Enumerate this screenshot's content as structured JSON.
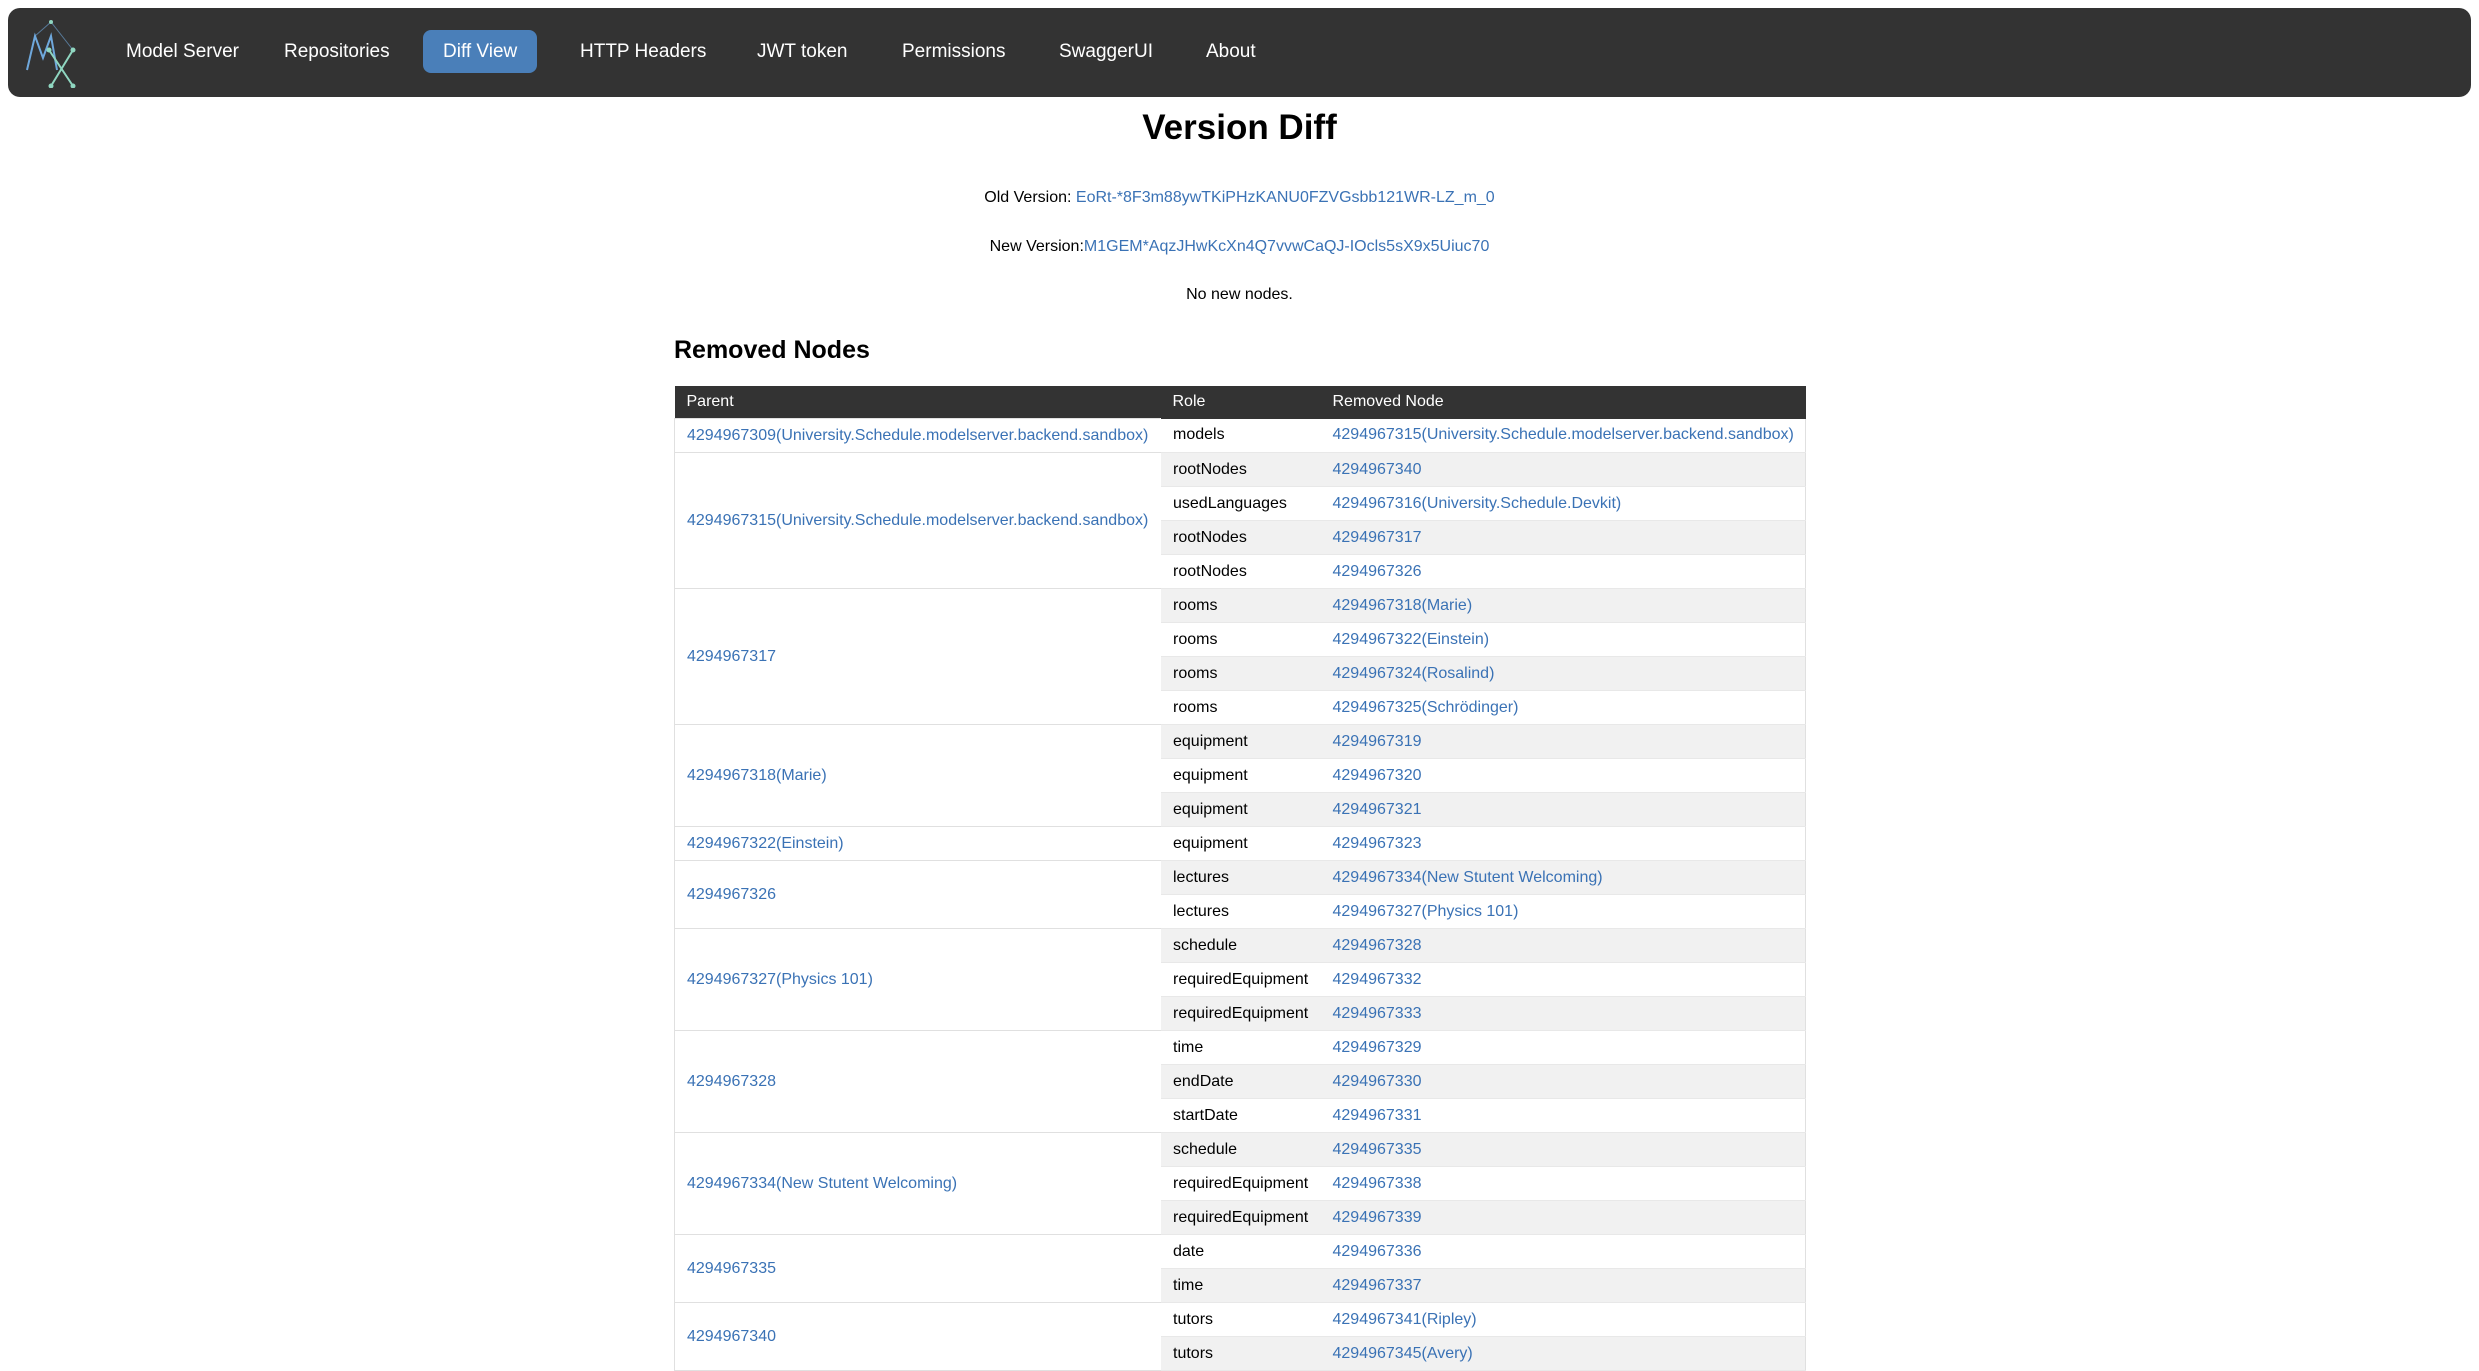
{
  "nav": {
    "items": [
      {
        "label": "Model Server",
        "active": false
      },
      {
        "label": "Repositories",
        "active": false
      },
      {
        "label": "Diff View",
        "active": true
      },
      {
        "label": "HTTP Headers",
        "active": false
      },
      {
        "label": "JWT token",
        "active": false
      },
      {
        "label": "Permissions",
        "active": false
      },
      {
        "label": "SwaggerUI",
        "active": false
      },
      {
        "label": "About",
        "active": false
      }
    ],
    "logo_icon": "mx-logo-icon"
  },
  "page": {
    "title": "Version Diff",
    "old_version_label": "Old Version:",
    "old_version_value": "EoRt-*8F3m88ywTKiPHzKANU0FZVGsbb121WR-LZ_m_0",
    "new_version_label": "New Version:",
    "new_version_value": "M1GEM*AqzJHwKcXn4Q7vvwCaQJ-IOcls5sX9x5Uiuc70",
    "no_new_nodes": "No new nodes."
  },
  "removed": {
    "title": "Removed Nodes",
    "headers": [
      "Parent",
      "Role",
      "Removed Node"
    ],
    "groups": [
      {
        "parent": "4294967309(University.Schedule.modelserver.backend.sandbox)",
        "rows": [
          {
            "role": "models",
            "node": "4294967315(University.Schedule.modelserver.backend.sandbox)"
          }
        ]
      },
      {
        "parent": "4294967315(University.Schedule.modelserver.backend.sandbox)",
        "rows": [
          {
            "role": "rootNodes",
            "node": "4294967340"
          },
          {
            "role": "usedLanguages",
            "node": "4294967316(University.Schedule.Devkit)"
          },
          {
            "role": "rootNodes",
            "node": "4294967317"
          },
          {
            "role": "rootNodes",
            "node": "4294967326"
          }
        ]
      },
      {
        "parent": "4294967317",
        "rows": [
          {
            "role": "rooms",
            "node": "4294967318(Marie)"
          },
          {
            "role": "rooms",
            "node": "4294967322(Einstein)"
          },
          {
            "role": "rooms",
            "node": "4294967324(Rosalind)"
          },
          {
            "role": "rooms",
            "node": "4294967325(Schrödinger)"
          }
        ]
      },
      {
        "parent": "4294967318(Marie)",
        "rows": [
          {
            "role": "equipment",
            "node": "4294967319"
          },
          {
            "role": "equipment",
            "node": "4294967320"
          },
          {
            "role": "equipment",
            "node": "4294967321"
          }
        ]
      },
      {
        "parent": "4294967322(Einstein)",
        "rows": [
          {
            "role": "equipment",
            "node": "4294967323"
          }
        ]
      },
      {
        "parent": "4294967326",
        "rows": [
          {
            "role": "lectures",
            "node": "4294967334(New Stutent Welcoming)"
          },
          {
            "role": "lectures",
            "node": "4294967327(Physics 101)"
          }
        ]
      },
      {
        "parent": "4294967327(Physics 101)",
        "rows": [
          {
            "role": "schedule",
            "node": "4294967328"
          },
          {
            "role": "requiredEquipment",
            "node": "4294967332"
          },
          {
            "role": "requiredEquipment",
            "node": "4294967333"
          }
        ]
      },
      {
        "parent": "4294967328",
        "rows": [
          {
            "role": "time",
            "node": "4294967329"
          },
          {
            "role": "endDate",
            "node": "4294967330"
          },
          {
            "role": "startDate",
            "node": "4294967331"
          }
        ]
      },
      {
        "parent": "4294967334(New Stutent Welcoming)",
        "rows": [
          {
            "role": "schedule",
            "node": "4294967335"
          },
          {
            "role": "requiredEquipment",
            "node": "4294967338"
          },
          {
            "role": "requiredEquipment",
            "node": "4294967339"
          }
        ]
      },
      {
        "parent": "4294967335",
        "rows": [
          {
            "role": "date",
            "node": "4294967336"
          },
          {
            "role": "time",
            "node": "4294967337"
          }
        ]
      },
      {
        "parent": "4294967340",
        "rows": [
          {
            "role": "tutors",
            "node": "4294967341(Ripley)"
          },
          {
            "role": "tutors",
            "node": "4294967345(Avery)"
          }
        ]
      }
    ]
  }
}
